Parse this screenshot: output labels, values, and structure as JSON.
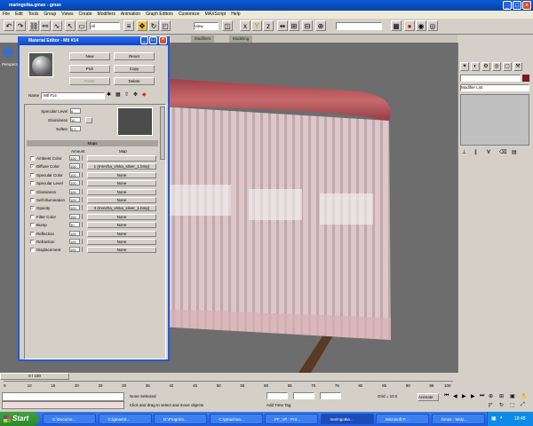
{
  "window": {
    "title": "maringotka.gmax - gmax"
  },
  "menu": [
    "File",
    "Edit",
    "Tools",
    "Group",
    "Views",
    "Create",
    "Modifiers",
    "Animation",
    "Graph Editors",
    "Customize",
    "MAXScript",
    "Help"
  ],
  "toolbar": {
    "selection_filter": "All",
    "coord_system": "View",
    "named_sel_placeholder": ""
  },
  "tabs": [
    "Modifiers",
    "Modeling"
  ],
  "viewport": {
    "label": "Perspective"
  },
  "material_editor": {
    "title": "Material Editor - Mtl #14",
    "buttons": {
      "new": "New",
      "reset": "Reset",
      "pick": "Pick",
      "copy": "Copy",
      "paste": "Paste",
      "delete": "Delete"
    },
    "name_label": "Name",
    "name_value": "Mtl #14",
    "specular_level_label": "Specular Level",
    "specular_level_value": "0",
    "glossiness_label": "Glossiness",
    "glossiness_value": "10",
    "soften_label": "Soften",
    "soften_value": "0.1",
    "maps_header": "Maps",
    "col_amount": "Amount",
    "col_map": "Map",
    "maps": [
      {
        "name": "Ambient Color",
        "amount": "100",
        "map": "",
        "checked": false
      },
      {
        "name": "Diffuse Color",
        "amount": "100",
        "map": "1 (mrezha_vlnka_silver_1.bmp)",
        "checked": true
      },
      {
        "name": "Specular Color",
        "amount": "100",
        "map": "None",
        "checked": false
      },
      {
        "name": "Specular Level",
        "amount": "100",
        "map": "None",
        "checked": false
      },
      {
        "name": "Glossiness",
        "amount": "100",
        "map": "None",
        "checked": false
      },
      {
        "name": "Self-Illumination",
        "amount": "100",
        "map": "None",
        "checked": false
      },
      {
        "name": "Opacity",
        "amount": "100",
        "map": "3 (mrezha_vlnka_silver_1.bmp)",
        "checked": true
      },
      {
        "name": "Filter Color",
        "amount": "100",
        "map": "None",
        "checked": false
      },
      {
        "name": "Bump",
        "amount": "30",
        "map": "None",
        "checked": false
      },
      {
        "name": "Reflection",
        "amount": "100",
        "map": "None",
        "checked": false
      },
      {
        "name": "Refraction",
        "amount": "100",
        "map": "None",
        "checked": false
      },
      {
        "name": "Displacement",
        "amount": "100",
        "map": "None",
        "checked": false
      }
    ]
  },
  "command_panel": {
    "modifier_list": "Modifier List"
  },
  "timeline": {
    "frame_label": "0 / 100",
    "ticks": [
      "0",
      "10",
      "15",
      "20",
      "25",
      "30",
      "35",
      "40",
      "45",
      "50",
      "55",
      "60",
      "65",
      "70",
      "75",
      "80",
      "85",
      "90",
      "95",
      "100"
    ]
  },
  "status": {
    "selection": "None Selected",
    "prompt": "Click and drag to select and move objects",
    "add_time_tag": "Add Time Tag",
    "grid": "Grid = 10.0",
    "animate": "Animate"
  },
  "taskbar": {
    "start": "Start",
    "tasks": [
      "C:\\Docume...",
      "C:\\gmax\\S...",
      "D:\\Program...",
      "C:\\gmax\\ma...",
      "PF_VP - Pro...",
      "maringotka...",
      "Microsoft P...",
      "Gmax - Maly..."
    ],
    "time": "18:48"
  }
}
